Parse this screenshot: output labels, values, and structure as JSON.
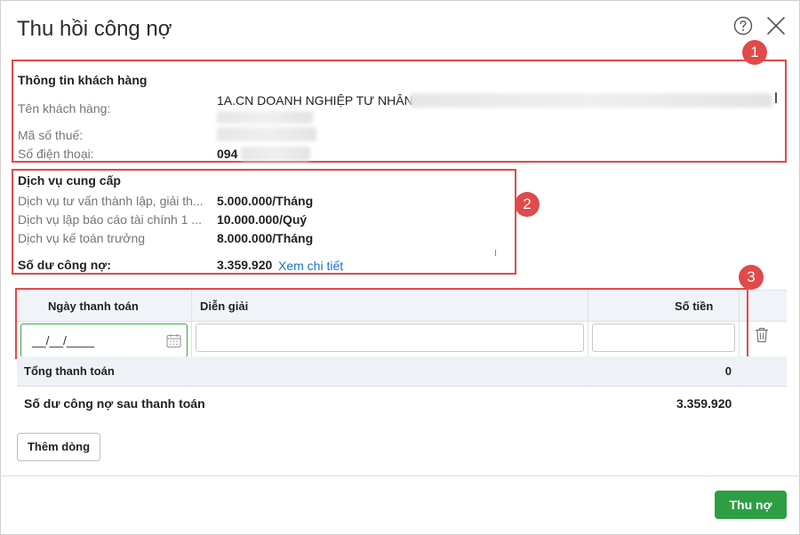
{
  "dialog": {
    "title": "Thu hồi công nợ",
    "help_icon": "help-circle-icon",
    "close_icon": "close-icon"
  },
  "annotations": [
    "1",
    "2",
    "3"
  ],
  "customer": {
    "section_title": "Thông tin khách hàng",
    "name_label": "Tên khách hàng:",
    "name_value": "1A.CN DOANH NGHIỆP TƯ NHÂN",
    "tax_label": "Mã số thuế:",
    "phone_label": "Số điện thoại:",
    "phone_value": "094"
  },
  "services": {
    "section_title": "Dịch vụ cung cấp",
    "items": [
      {
        "name": "Dịch vụ tư vấn thành lập, giải th...",
        "price": "5.000.000/Tháng"
      },
      {
        "name": "Dịch vụ lập báo cáo tài chính 1 ...",
        "price": "10.000.000/Quý"
      },
      {
        "name": "Dịch vụ kế toán trưởng",
        "price": "8.000.000/Tháng"
      }
    ],
    "balance_label": "Số dư công nợ:",
    "balance_value": "3.359.920",
    "detail_link": "Xem chi tiết"
  },
  "payment_table": {
    "columns": [
      "Ngày thanh toán",
      "Diễn giải",
      "Số tiền"
    ],
    "date_placeholder": "__/__/____",
    "total_label": "Tổng thanh toán",
    "total_value": "0",
    "after_label": "Số dư công nợ sau thanh toán",
    "after_value": "3.359.920"
  },
  "buttons": {
    "add_row": "Thêm dòng",
    "collect": "Thu nợ"
  },
  "colors": {
    "annotation": "#e04a4a",
    "primary": "#2e9e45",
    "link": "#1a73c8"
  }
}
